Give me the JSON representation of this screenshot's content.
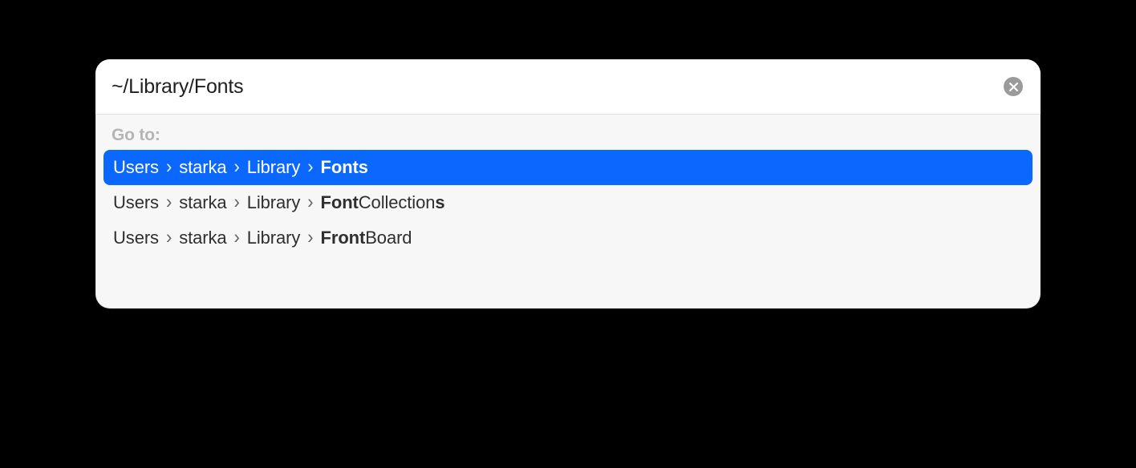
{
  "input": {
    "value": "~/Library/Fonts"
  },
  "section_label": "Go to:",
  "separator": "›",
  "results": [
    {
      "selected": true,
      "segments": [
        {
          "text": "Users",
          "bold": false
        },
        {
          "text": "starka",
          "bold": false
        },
        {
          "text": "Library",
          "bold": false
        },
        {
          "text": "Fonts",
          "bold": true
        }
      ]
    },
    {
      "selected": false,
      "segments": [
        {
          "text": "Users",
          "bold": false
        },
        {
          "text": "starka",
          "bold": false
        },
        {
          "text": "Library",
          "bold": false
        },
        {
          "parts": [
            {
              "text": "Font",
              "bold": true
            },
            {
              "text": "Collection",
              "bold": false
            },
            {
              "text": "s",
              "bold": true
            }
          ]
        }
      ]
    },
    {
      "selected": false,
      "segments": [
        {
          "text": "Users",
          "bold": false
        },
        {
          "text": "starka",
          "bold": false
        },
        {
          "text": "Library",
          "bold": false
        },
        {
          "parts": [
            {
              "text": "Fr",
              "bold": true
            },
            {
              "text": "ont",
              "bold": true
            },
            {
              "text": "Board",
              "bold": false
            }
          ]
        }
      ]
    }
  ]
}
